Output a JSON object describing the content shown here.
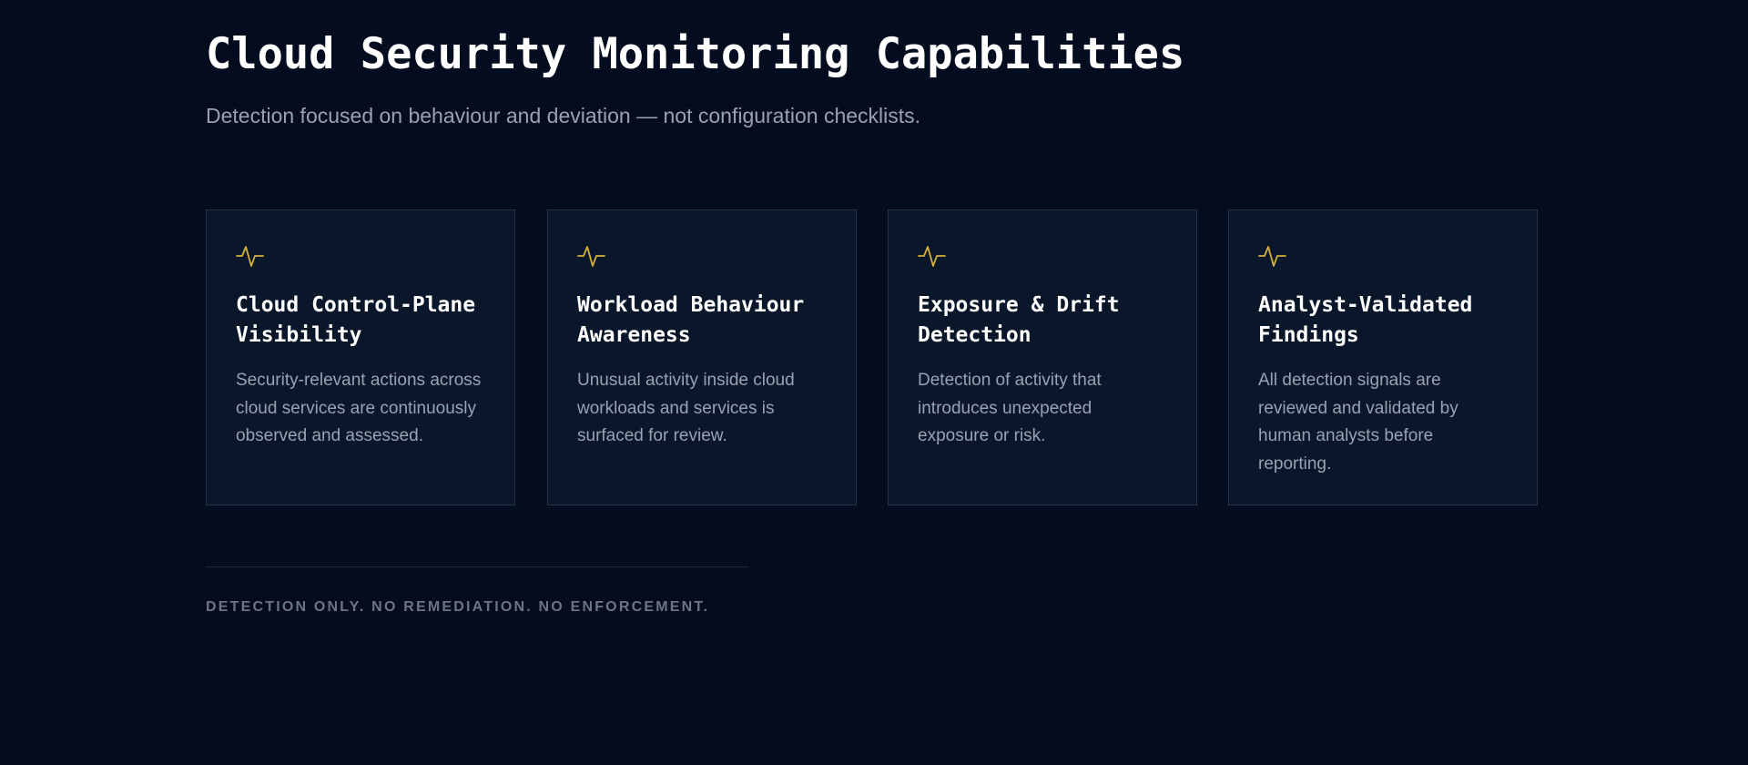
{
  "header": {
    "title": "Cloud Security Monitoring Capabilities",
    "subtitle": "Detection focused on behaviour and deviation — not configuration checklists."
  },
  "cards": [
    {
      "icon": "activity-pulse-icon",
      "title": "Cloud Control-Plane Visibility",
      "description": "Security-relevant actions across cloud services are continuously observed and assessed."
    },
    {
      "icon": "activity-pulse-icon",
      "title": "Workload Behaviour Awareness",
      "description": "Unusual activity inside cloud workloads and services is surfaced for review."
    },
    {
      "icon": "activity-pulse-icon",
      "title": "Exposure & Drift Detection",
      "description": "Detection of activity that introduces unexpected exposure or risk."
    },
    {
      "icon": "activity-pulse-icon",
      "title": "Analyst-Validated Findings",
      "description": "All detection signals are reviewed and validated by human analysts before reporting."
    }
  ],
  "footer": {
    "note": "DETECTION ONLY. NO REMEDIATION. NO ENFORCEMENT."
  },
  "colors": {
    "background": "#040d1f",
    "card_background": "#0a172a",
    "card_border": "#273344",
    "accent": "#d4b13a",
    "title_text": "#ffffff",
    "body_text": "#98a2b3",
    "muted_text": "#6b7587"
  }
}
